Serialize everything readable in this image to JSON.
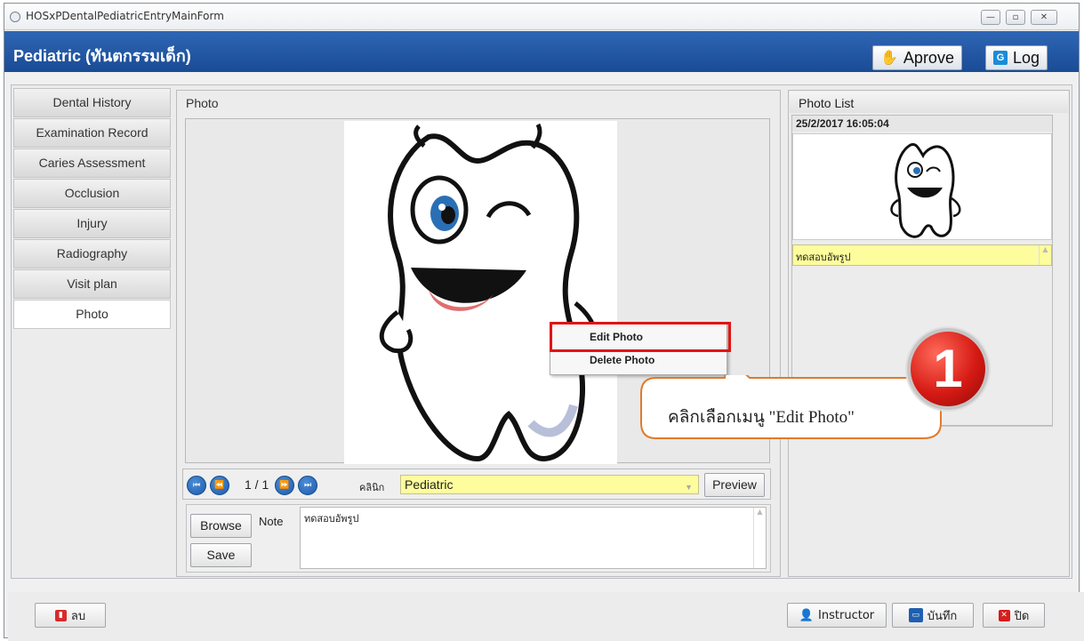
{
  "window": {
    "title": "HOSxPDentalPediatricEntryMainForm"
  },
  "header": {
    "title": "Pediatric (ทันตกรรมเด็ก)",
    "approve_label": "Aprove",
    "log_label": "Log"
  },
  "tabs": [
    "Dental History",
    "Examination Record",
    "Caries Assessment",
    "Occlusion",
    "Injury",
    "Radiography",
    "Visit plan",
    "Photo"
  ],
  "active_tab": "Photo",
  "photo_panel": {
    "caption": "Photo",
    "counter": "1 / 1",
    "clinic_label": "คลินิก",
    "clinic_value": "Pediatric",
    "preview_label": "Preview",
    "browse_label": "Browse",
    "save_label": "Save",
    "note_label": "Note",
    "note_value": "ทดสอบอัพรูป"
  },
  "photo_list": {
    "caption": "Photo List",
    "items": [
      {
        "date": "25/2/2017 16:05:04",
        "note": "ทดสอบอัพรูป"
      }
    ]
  },
  "context_menu": {
    "items": [
      "Edit Photo",
      "Delete Photo"
    ]
  },
  "annotation": {
    "number": "1",
    "callout": "คลิกเลือกเมนู \"Edit Photo\""
  },
  "footer": {
    "delete_label": "ลบ",
    "instructor_label": "Instructor",
    "save_label": "บันทึก",
    "close_label": "ปิด"
  },
  "colors": {
    "header_blue": "#1f56a3",
    "highlight_yellow": "#fdfd9d",
    "annotation_red": "#e01515"
  }
}
